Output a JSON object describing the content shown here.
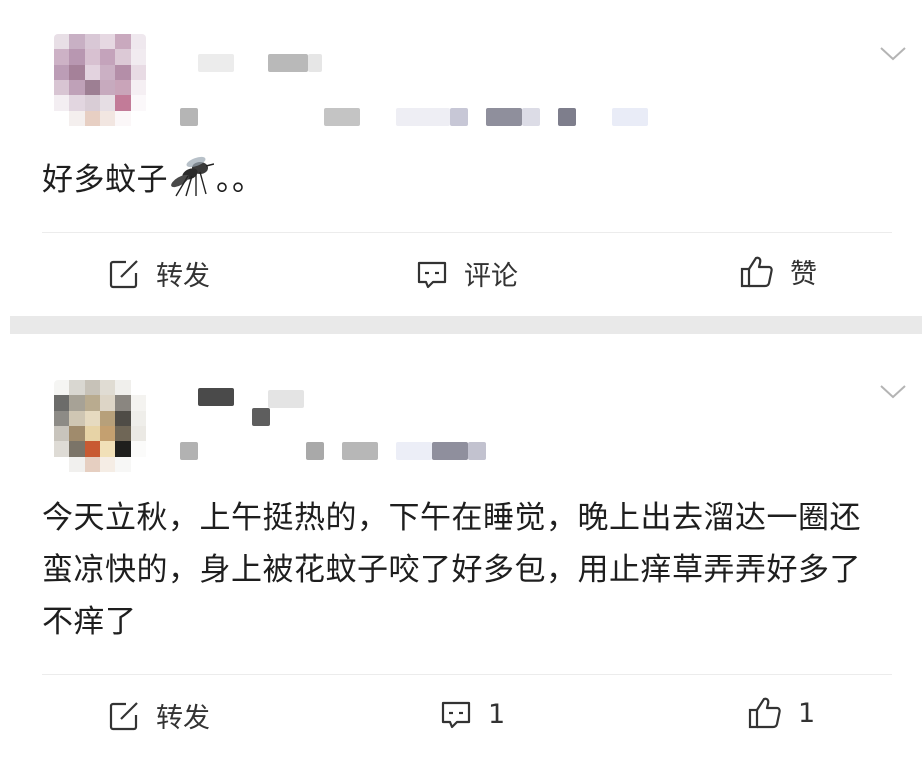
{
  "posts": [
    {
      "content": "好多蚊子",
      "trailing": "。。",
      "actions": {
        "repost": "转发",
        "comment": "评论",
        "like": "赞"
      }
    },
    {
      "content": "今天立秋，上午挺热的，下午在睡觉，晚上出去溜达一圈还蛮凉快的，身上被花蚊子咬了好多包，用止痒草弄弄好多了不痒了",
      "actions": {
        "repost": "转发",
        "comment": "1",
        "like": "1"
      }
    }
  ],
  "icons": {
    "repost": "repost-icon",
    "comment": "comment-icon",
    "like": "thumbs-up-icon",
    "more": "chevron-down-icon",
    "emoji": "mosquito-emoji"
  },
  "colors": {
    "text": "#1e1e1e",
    "icon": "#333333",
    "separator": "#e9e9e9"
  }
}
